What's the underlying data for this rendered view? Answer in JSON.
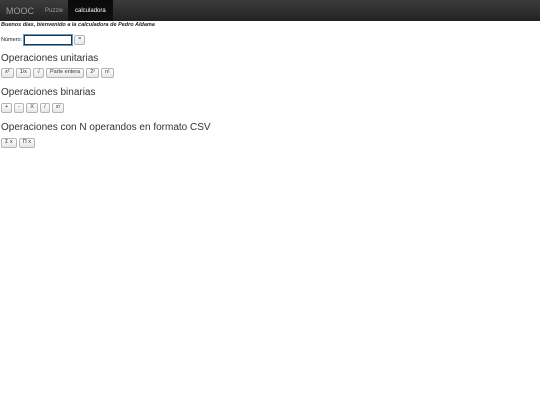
{
  "navbar": {
    "brand": "MOOC",
    "items": [
      {
        "label": "Puzzle",
        "active": false
      },
      {
        "label": "calculadora",
        "active": true
      }
    ]
  },
  "welcome": "Buenos días, bienvenido a la calculadora de Pedro Aldama",
  "number": {
    "label": "Número:",
    "value": "",
    "equals_label": "="
  },
  "unary": {
    "title": "Operaciones unitarias",
    "buttons": [
      "x²",
      "1/x",
      "√",
      "Parte entera",
      "2ˣ",
      "n!"
    ]
  },
  "binary": {
    "title": "Operaciones binarias",
    "buttons": [
      "+",
      "-",
      "X",
      "/",
      "xʸ"
    ]
  },
  "csv": {
    "title": "Operaciones con N operandos en formato CSV",
    "buttons": [
      "Σ x",
      "Π x"
    ]
  },
  "colors": {
    "navbar": "#222222",
    "active_tab": "#080808",
    "text": "#333333"
  }
}
